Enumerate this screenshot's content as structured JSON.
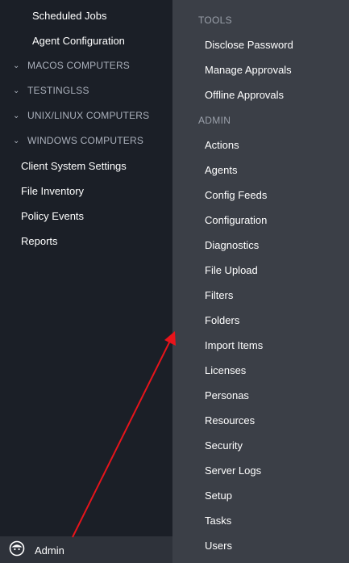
{
  "left_nav": {
    "scheduled_jobs": "Scheduled Jobs",
    "agent_configuration": "Agent Configuration",
    "groups": [
      "MACOS COMPUTERS",
      "TESTINGLSS",
      "UNIX/LINUX COMPUTERS",
      "WINDOWS COMPUTERS"
    ],
    "client_system_settings": "Client System Settings",
    "file_inventory": "File Inventory",
    "policy_events": "Policy Events",
    "reports": "Reports"
  },
  "user": {
    "name": "Admin",
    "avatar_icon": "user-avatar-icon"
  },
  "menu": {
    "tools_header": "TOOLS",
    "tools": [
      "Disclose Password",
      "Manage Approvals",
      "Offline Approvals"
    ],
    "admin_header": "ADMIN",
    "admin": [
      "Actions",
      "Agents",
      "Config Feeds",
      "Configuration",
      "Diagnostics",
      "File Upload",
      "Filters",
      "Folders",
      "Import Items",
      "Licenses",
      "Personas",
      "Resources",
      "Security",
      "Server Logs",
      "Setup",
      "Tasks",
      "Users"
    ]
  },
  "colors": {
    "annotation_arrow": "#e8141b",
    "left_bg": "#1b1f27",
    "menu_bg": "#3b3f47"
  }
}
